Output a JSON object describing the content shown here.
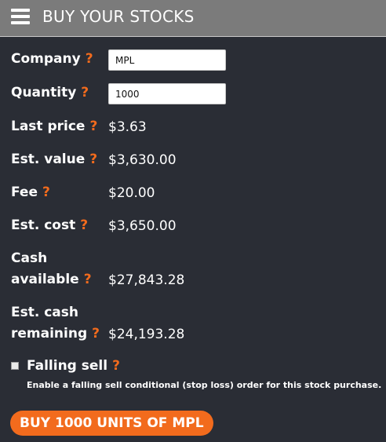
{
  "header": {
    "title": "BUY YOUR STOCKS",
    "menu_icon": "hamburger-menu-icon"
  },
  "form": {
    "help_mark": "?",
    "company": {
      "label": "Company",
      "value": "MPL"
    },
    "quantity": {
      "label": "Quantity",
      "value": "1000"
    },
    "last_price": {
      "label": "Last price",
      "value": "$3.63"
    },
    "est_value": {
      "label": "Est. value",
      "value": "$3,630.00"
    },
    "fee": {
      "label": "Fee",
      "value": "$20.00"
    },
    "est_cost": {
      "label": "Est. cost",
      "value": "$3,650.00"
    },
    "cash_available": {
      "label_line1": "Cash",
      "label_line2": "available",
      "value": "$27,843.28"
    },
    "est_cash_remaining": {
      "label_line1": "Est. cash",
      "label_line2": "remaining",
      "value": "$24,193.28"
    }
  },
  "falling_sell": {
    "label": "Falling sell",
    "checked": false,
    "description": "Enable a falling sell conditional (stop loss) order for this stock purchase."
  },
  "buy_button": {
    "label": "BUY 1000 UNITS OF MPL"
  },
  "colors": {
    "background": "#2a2d35",
    "header": "#7b7b7b",
    "accent": "#f26b1d",
    "text": "#ffffff"
  }
}
